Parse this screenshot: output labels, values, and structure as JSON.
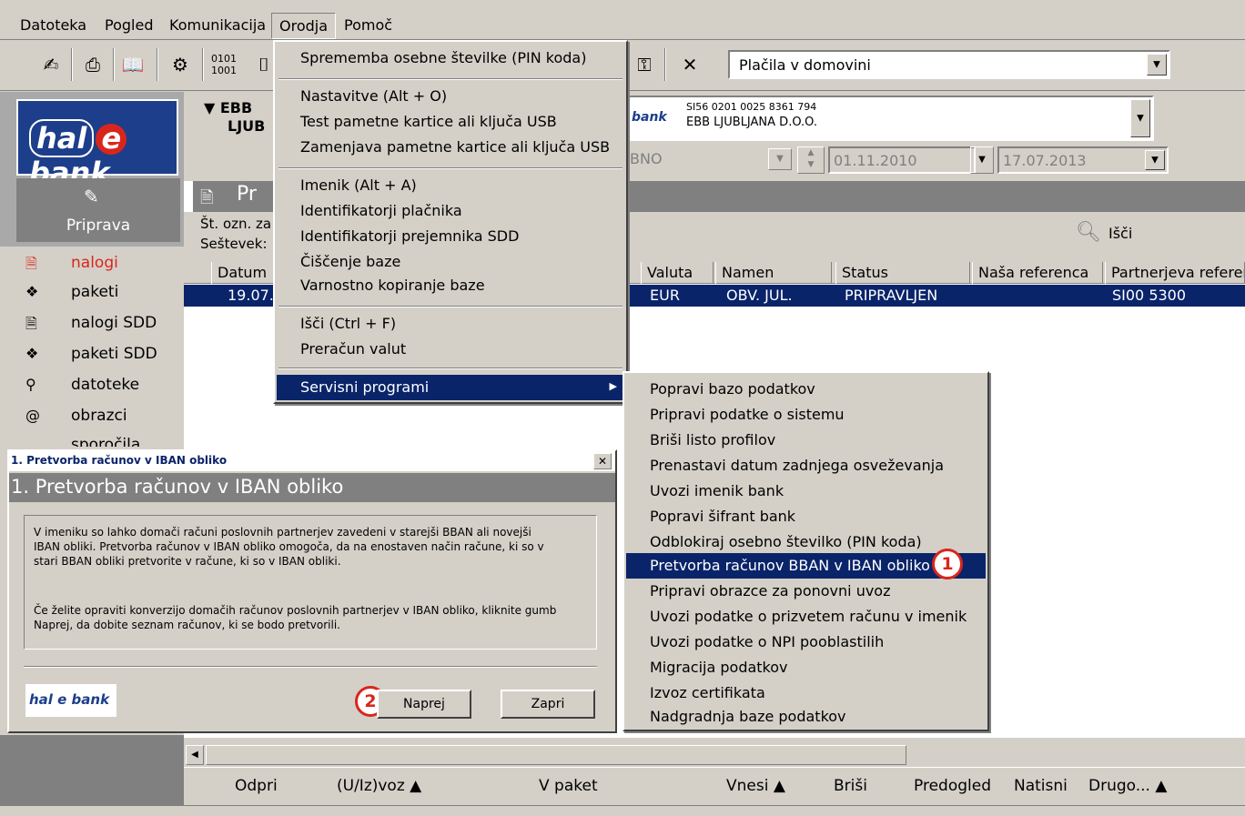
{
  "menubar": {
    "items": [
      "Datoteka",
      "Pogled",
      "Komunikacija",
      "Orodja",
      "Pomoč"
    ]
  },
  "toolbar": {
    "payments_combo": "Plačila v domovini"
  },
  "bank": {
    "name_line1": "EBB",
    "name_line2": "LJUB",
    "brand": "hal e bank",
    "brand_small": "bank",
    "account_iban": "SI56 0201 0025 8361 794",
    "account_holder": "EBB LJUBLJANA D.O.O.",
    "filter_text": "BNO",
    "date_from": "01.11.2010",
    "date_to": "17.07.2013"
  },
  "sidebar": {
    "panel_label": "Priprava",
    "items": [
      {
        "label": "nalogi",
        "icon": "orders-icon"
      },
      {
        "label": "paketi",
        "icon": "packages-icon"
      },
      {
        "label": "nalogi SDD",
        "icon": "sdd-orders-icon"
      },
      {
        "label": "paketi SDD",
        "icon": "sdd-packages-icon"
      },
      {
        "label": "datoteke",
        "icon": "files-icon"
      },
      {
        "label": "obrazci",
        "icon": "forms-icon"
      },
      {
        "label": "sporočila",
        "icon": "messages-icon"
      }
    ]
  },
  "main": {
    "section_title": "Pr",
    "info_line1": "Št. ozn. za",
    "info_line2": "Seštevek:",
    "search_label": "Išči",
    "columns": [
      "Datum",
      "Valuta",
      "Namen",
      "Status",
      "Naša referenca",
      "Partnerjeva referen"
    ],
    "row": {
      "date": "19.07.",
      "currency": "EUR",
      "purpose": "OBV. JUL.",
      "status": "PRIPRAVLJEN",
      "partner_ref": "SI00 5300"
    }
  },
  "dropdown": {
    "group1": [
      "Sprememba osebne številke (PIN koda)"
    ],
    "group2": [
      "Nastavitve (Alt + O)",
      "Test pametne kartice ali ključa USB",
      "Zamenjava pametne kartice ali ključa USB"
    ],
    "group3": [
      "Imenik (Alt + A)",
      "Identifikatorji plačnika",
      "Identifikatorji prejemnika SDD",
      "Čiščenje baze",
      "Varnostno kopiranje baze"
    ],
    "group4": [
      "Išči (Ctrl + F)",
      "Preračun valut"
    ],
    "servisni": "Servisni programi"
  },
  "submenu": {
    "items": [
      "Popravi bazo podatkov",
      "Pripravi podatke o sistemu",
      "Briši listo profilov",
      "Prenastavi datum zadnjega osveževanja",
      "Uvozi imenik bank",
      "Popravi šifrant bank",
      "Odblokiraj osebno številko (PIN koda)",
      "Pretvorba računov BBAN v IBAN obliko",
      "Pripravi obrazce za ponovni uvoz",
      "Uvozi podatke o prizvetem računu v imenik",
      "Uvozi podatke o NPI pooblastilih",
      "Migracija podatkov",
      "Izvoz certifikata",
      "Nadgradnja baze podatkov"
    ],
    "highlight_index": 7
  },
  "dialog": {
    "title": "1. Pretvorba računov v IBAN obliko",
    "heading": "1. Pretvorba računov v IBAN obliko",
    "para1": "V imeniku so lahko domači računi poslovnih partnerjev zavedeni v starejši BBAN ali novejši IBAN obliki. Pretvorba računov v IBAN obliko omogoča, da na enostaven način račune, ki so v stari BBAN obliki pretvorite v račune, ki so v IBAN obliki.",
    "para2": "Če želite opraviti konverzijo domačih računov poslovnih partnerjev v IBAN obliko, kliknite gumb Naprej, da dobite seznam računov, ki se bodo pretvorili.",
    "next_button": "Naprej",
    "close_button": "Zapri",
    "close_x": "✕"
  },
  "annotations": {
    "step1": "1",
    "step2": "2"
  },
  "bottombar": {
    "buttons": [
      "Odpri",
      "(U/Iz)voz ▲",
      "V paket",
      "Vnesi ▲",
      "Briši",
      "Predogled",
      "Natisni",
      "Drugo... ▲"
    ]
  },
  "colors": {
    "selection": "#0a246a",
    "annotation": "#d9261c",
    "logo_blue": "#1d3e8a",
    "face": "#d4d0c8"
  }
}
